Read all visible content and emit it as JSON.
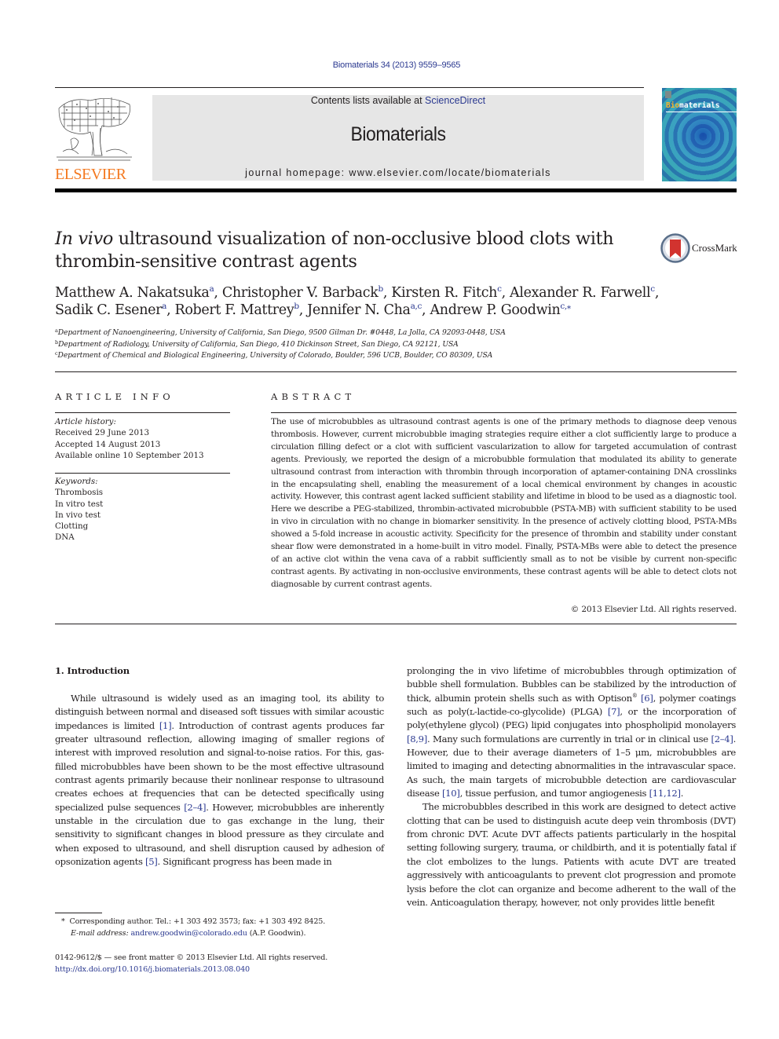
{
  "header": {
    "citation": "Biomaterials 34 (2013) 9559–9565",
    "contents_prefix": "Contents lists available at ",
    "contents_link": "ScienceDirect",
    "journal_name": "Biomaterials",
    "homepage": "journal homepage: www.elsevier.com/locate/biomaterials",
    "publisher_logo_text": "ELSEVIER",
    "cover_title_part1": "Bio",
    "cover_title_part2": "materials",
    "crossmark_label": "CrossMark"
  },
  "colors": {
    "link": "#2b3990",
    "elsevier_orange": "#f47920",
    "banner_gray": "#e6e6e6",
    "text": "#231f20"
  },
  "article": {
    "title_italic": "In vivo",
    "title_rest": " ultrasound visualization of non-occlusive blood clots with thrombin-sensitive contrast agents",
    "authors": [
      {
        "name": "Matthew A. Nakatsuka",
        "sup": "a",
        "sep": ", "
      },
      {
        "name": "Christopher V. Barback",
        "sup": "b",
        "sep": ", "
      },
      {
        "name": "Kirsten R. Fitch",
        "sup": "c",
        "sep": ", "
      },
      {
        "name": "Alexander R. Farwell",
        "sup": "c",
        "sep": ","
      },
      {
        "name": "Sadik C. Esener",
        "sup": "a",
        "sep": ", "
      },
      {
        "name": "Robert F. Mattrey",
        "sup": "b",
        "sep": ", "
      },
      {
        "name": "Jennifer N. Cha",
        "sup": "a,c",
        "sep": ", "
      },
      {
        "name": "Andrew P. Goodwin",
        "sup": "c,⁎",
        "sep": ""
      }
    ],
    "affiliations": [
      {
        "mark": "a",
        "text": "Department of Nanoengineering, University of California, San Diego, 9500 Gilman Dr. #0448, La Jolla, CA 92093-0448, USA"
      },
      {
        "mark": "b",
        "text": "Department of Radiology, University of California, San Diego, 410 Dickinson Street, San Diego, CA 92121, USA"
      },
      {
        "mark": "c",
        "text": "Department of Chemical and Biological Engineering, University of Colorado, Boulder, 596 UCB, Boulder, CO 80309, USA"
      }
    ]
  },
  "article_info": {
    "heading": "ARTICLE INFO",
    "history_label": "Article history:",
    "history": [
      "Received 29 June 2013",
      "Accepted 14 August 2013",
      "Available online 10 September 2013"
    ],
    "keywords_label": "Keywords:",
    "keywords": [
      "Thrombosis",
      "In vitro test",
      "In vivo test",
      "Clotting",
      "DNA"
    ]
  },
  "abstract": {
    "heading": "ABSTRACT",
    "text": "The use of microbubbles as ultrasound contrast agents is one of the primary methods to diagnose deep venous thrombosis. However, current microbubble imaging strategies require either a clot sufficiently large to produce a circulation filling defect or a clot with sufficient vascularization to allow for targeted accumulation of contrast agents. Previously, we reported the design of a microbubble formulation that modulated its ability to generate ultrasound contrast from interaction with thrombin through incorpo­ration of aptamer-containing DNA crosslinks in the encapsulating shell, enabling the measurement of a local chemical environment by changes in acoustic activity. However, this contrast agent lacked sufficient stability and lifetime in blood to be used as a diagnostic tool. Here we describe a PEG-stabilized, thrombin-activated microbubble (PSTA-MB) with sufficient stability to be used in vivo in circulation with no change in biomarker sensitivity. In the presence of actively clotting blood, PSTA-MBs showed a 5-fold increase in acoustic activity. Specificity for the presence of thrombin and stability under constant shear flow were demonstrated in a home-built in vitro model. Finally, PSTA-MBs were able to detect the presence of an active clot within the vena cava of a rabbit sufficiently small as to not be visible by current non-specific contrast agents. By activating in non-occlusive environments, these contrast agents will be able to detect clots not diagnosable by current contrast agents.",
    "copyright": "© 2013 Elsevier Ltd. All rights reserved."
  },
  "body": {
    "section_heading": "1.  Introduction",
    "left_col": [
      {
        "t": "While ultrasound is widely used as an imaging tool, its ability to distinguish between normal and diseased soft tissues with similar acoustic impedances is limited "
      },
      {
        "ref": "[1]"
      },
      {
        "t": ". Introduction of contrast agents produces far greater ultrasound reflection, allowing imaging of smaller regions of interest with improved resolution and signal-to-noise ratios. For this, gas-filled microbubbles have been shown to be the most effective ultrasound contrast agents primarily because their nonlinear response to ultrasound creates echoes at fre­quencies that can be detected specifically using specialized pulse sequences "
      },
      {
        "ref": "[2–4]"
      },
      {
        "t": ". However, microbubbles are inherently unstable in the circulation due to gas exchange in the lung, their sensitivity to significant changes in blood pressure as they circulate and when exposed to ultrasound, and shell disruption caused by adhesion of opsonization agents "
      },
      {
        "ref": "[5]"
      },
      {
        "t": ". Significant progress has been made in"
      }
    ],
    "right_col_p1": [
      {
        "t": "prolonging the in vivo lifetime of microbubbles through optimi­zation of bubble shell formulation. Bubbles can be stabilized by the introduction of thick, albumin protein shells such as with Optison"
      },
      {
        "sup": "®"
      },
      {
        "t": " "
      },
      {
        "ref": "[6]"
      },
      {
        "t": ", polymer coatings such as poly(ʟ-lactide-co-glycolide) (PLGA) "
      },
      {
        "ref": "[7]"
      },
      {
        "t": ", or the incorporation of poly(ethylene glycol) (PEG) lipid con­jugates into phospholipid monolayers "
      },
      {
        "ref": "[8,9]"
      },
      {
        "t": ". Many such formula­tions are currently in trial or in clinical use "
      },
      {
        "ref": "[2–4]"
      },
      {
        "t": ". However, due to their average diameters of 1–5 μm, microbubbles are limited to imaging and detecting abnormalities in the intravascular space. As such, the main targets of microbubble detection are cardiovascular disease "
      },
      {
        "ref": "[10]"
      },
      {
        "t": ", tissue perfusion, and tumor angiogenesis "
      },
      {
        "ref": "[11,12]"
      },
      {
        "t": "."
      }
    ],
    "right_col_p2": "The microbubbles described in this work are designed to detect active clotting that can be used to distinguish acute deep vein thrombosis (DVT) from chronic DVT. Acute DVT affects patients particularly in the hospital setting following surgery, trauma, or childbirth, and it is potentially fatal if the clot embolizes to the lungs. Patients with acute DVT are treated aggressively with anti­coagulants to prevent clot progression and promote lysis before the clot can organize and become adherent to the wall of the vein. Anticoagulation therapy, however, not only provides little benefit"
  },
  "footnotes": {
    "corresponding_mark": "*",
    "corresponding": "Corresponding author. Tel.: +1 303 492 3573; fax: +1 303 492 8425.",
    "email_label": "E-mail address:",
    "email": "andrew.goodwin@colorado.edu",
    "email_suffix": " (A.P. Goodwin).",
    "front_matter": "0142-9612/$ — see front matter © 2013 Elsevier Ltd. All rights reserved.",
    "doi": "http://dx.doi.org/10.1016/j.biomaterials.2013.08.040"
  }
}
